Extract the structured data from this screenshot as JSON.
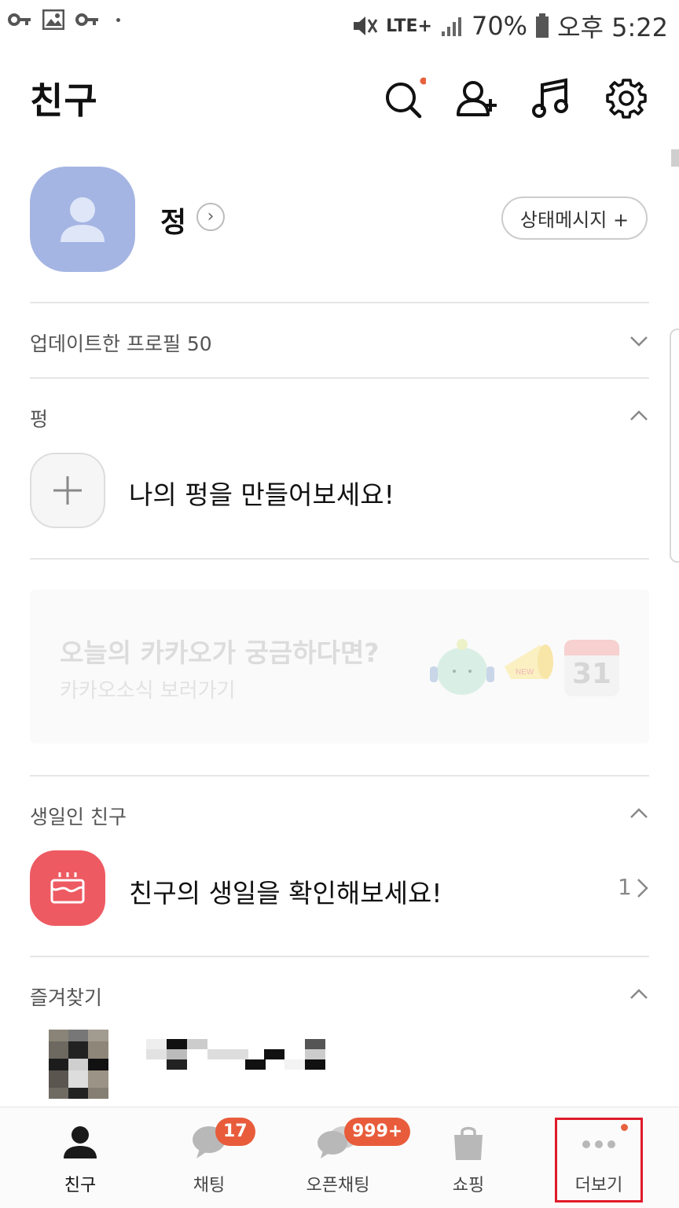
{
  "status_bar": {
    "battery": "70%",
    "network": "LTE+",
    "time": "오후 5:22"
  },
  "header": {
    "title": "친구"
  },
  "profile": {
    "name": "정",
    "status_button": "상태메시지 +"
  },
  "updated_profiles": {
    "label": "업데이트한 프로필 50"
  },
  "pung": {
    "title": "펑",
    "prompt": "나의 펑을 만들어보세요!"
  },
  "banner": {
    "title": "오늘의 카카오가 궁금하다면?",
    "subtitle": "카카오소식 보러가기",
    "calendar_day": "31",
    "megaphone_tag": "NEW"
  },
  "birthday": {
    "title": "생일인 친구",
    "prompt": "친구의 생일을 확인해보세요!",
    "count": "1"
  },
  "favorites": {
    "title": "즐겨찾기"
  },
  "bottom_nav": {
    "items": [
      {
        "label": "친구"
      },
      {
        "label": "채팅",
        "badge": "17"
      },
      {
        "label": "오픈채팅",
        "badge": "999+"
      },
      {
        "label": "쇼핑"
      },
      {
        "label": "더보기"
      }
    ]
  },
  "colors": {
    "accent": "#e85c3b",
    "avatar": "#a5b5e3",
    "birthday": "#ee5a62",
    "highlight": "#e01b2a"
  }
}
